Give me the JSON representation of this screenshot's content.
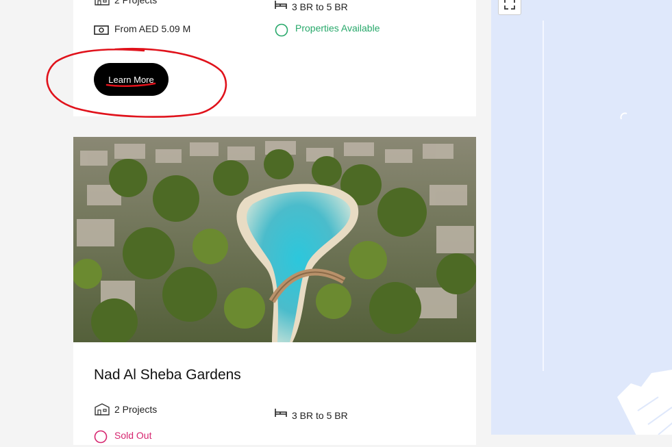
{
  "card_top": {
    "projects_label": "2 Projects",
    "bedrooms_label": "3 BR to 5 BR",
    "price_label": "From AED  5.09 M",
    "availability_label": "Properties Available",
    "learn_more_label": "Learn More"
  },
  "card_bottom": {
    "title": "Nad Al Sheba Gardens",
    "projects_label": "2 Projects",
    "bedrooms_label": "3 BR to 5 BR",
    "status_label": "Sold Out"
  },
  "colors": {
    "available_green": "#27a86a",
    "sold_out_pink": "#d6246e",
    "button_black": "#000000",
    "annotation_red": "#e0121b",
    "map_water": "#dfe8fb"
  },
  "icons": {
    "projects": "building-icon",
    "bedrooms": "bed-icon",
    "price": "banknote-icon",
    "availability": "circle-status-icon",
    "fullscreen": "fullscreen-icon"
  }
}
